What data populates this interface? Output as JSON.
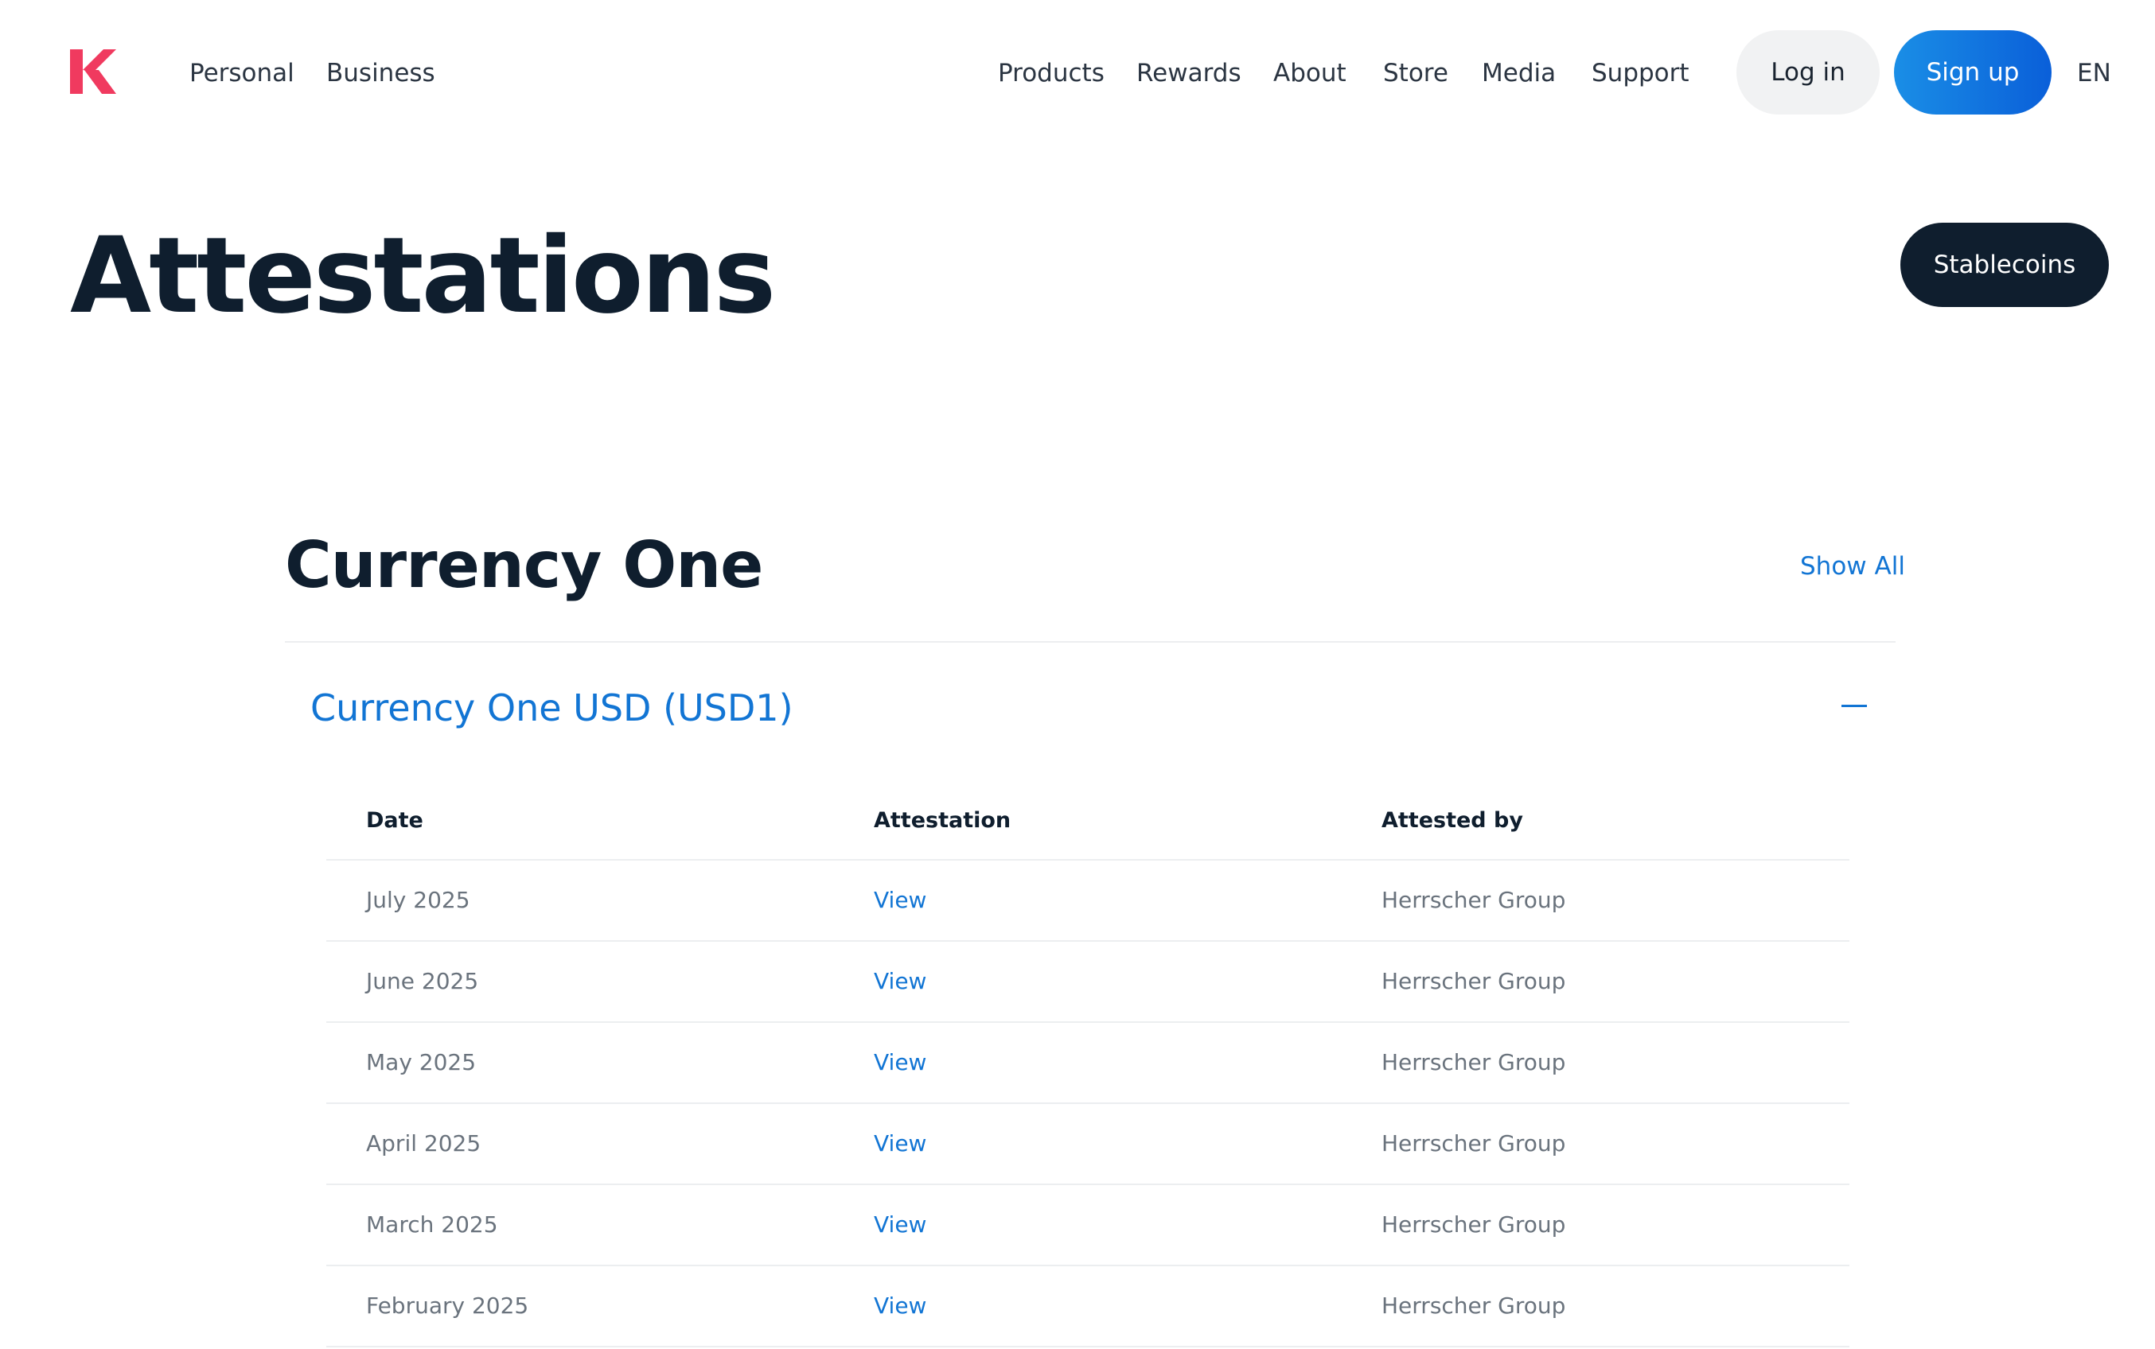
{
  "nav": {
    "logo_icon": "k-logo-icon",
    "logo_color": "#f03a5f",
    "left_links": [
      "Personal",
      "Business"
    ],
    "right_links": [
      "Products",
      "Rewards",
      "About",
      "Store",
      "Media",
      "Support"
    ],
    "login_label": "Log in",
    "signup_label": "Sign up",
    "language": "EN"
  },
  "hero": {
    "title": "Attestations",
    "button_label": "Stablecoins"
  },
  "section": {
    "title": "Currency One",
    "show_all_label": "Show All",
    "accordion": {
      "title": "Currency One USD (USD1)",
      "expanded": true,
      "toggle_icon": "minus-icon",
      "columns": [
        "Date",
        "Attestation",
        "Attested by"
      ],
      "rows": [
        {
          "date": "July 2025",
          "attestation": "View",
          "attested_by": "Herrscher Group"
        },
        {
          "date": "June 2025",
          "attestation": "View",
          "attested_by": "Herrscher Group"
        },
        {
          "date": "May 2025",
          "attestation": "View",
          "attested_by": "Herrscher Group"
        },
        {
          "date": "April 2025",
          "attestation": "View",
          "attested_by": "Herrscher Group"
        },
        {
          "date": "March 2025",
          "attestation": "View",
          "attested_by": "Herrscher Group"
        },
        {
          "date": "February 2025",
          "attestation": "View",
          "attested_by": "Herrscher Group"
        }
      ]
    }
  },
  "colors": {
    "accent_blue": "#1275d4",
    "dark_navy": "#0f1e2e",
    "signup_gradient_start": "#1a8ee6",
    "signup_gradient_end": "#0a5fd9"
  }
}
